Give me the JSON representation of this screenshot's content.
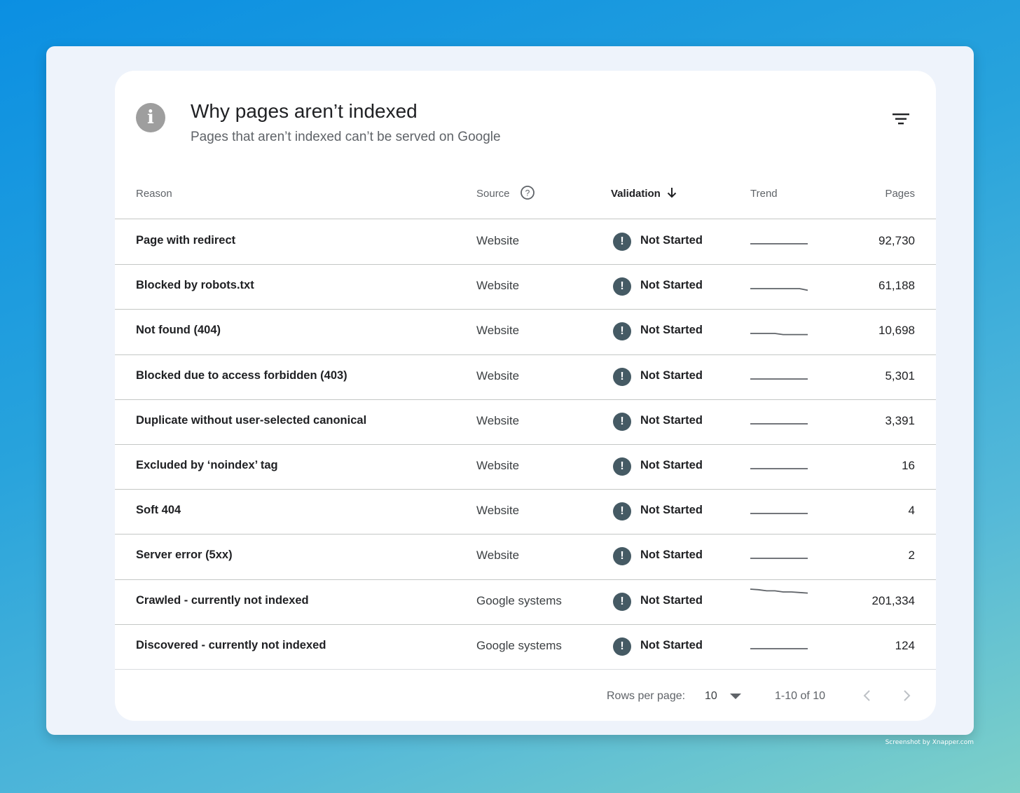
{
  "header": {
    "title": "Why pages aren’t indexed",
    "subtitle": "Pages that aren’t indexed can’t be served on Google",
    "info_icon": "info-icon",
    "filter_icon": "filter-icon"
  },
  "columns": {
    "reason": "Reason",
    "source": "Source",
    "validation": "Validation",
    "trend": "Trend",
    "pages": "Pages"
  },
  "rows": [
    {
      "reason": "Page with redirect",
      "source": "Website",
      "validation": "Not Started",
      "pages": "92,730",
      "trend": [
        1,
        1,
        1,
        1,
        1,
        1,
        1,
        1
      ]
    },
    {
      "reason": "Blocked by robots.txt",
      "source": "Website",
      "validation": "Not Started",
      "pages": "61,188",
      "trend": [
        1,
        1,
        1,
        1,
        1,
        1,
        1,
        0.97
      ]
    },
    {
      "reason": "Not found (404)",
      "source": "Website",
      "validation": "Not Started",
      "pages": "10,698",
      "trend": [
        1,
        1,
        1,
        1,
        0.98,
        0.98,
        0.98,
        0.98
      ]
    },
    {
      "reason": "Blocked due to access forbidden (403)",
      "source": "Website",
      "validation": "Not Started",
      "pages": "5,301",
      "trend": [
        1,
        1,
        1,
        1,
        1,
        1,
        1,
        1
      ]
    },
    {
      "reason": "Duplicate without user-selected canonical",
      "source": "Website",
      "validation": "Not Started",
      "pages": "3,391",
      "trend": [
        1,
        1,
        1,
        1,
        1,
        1,
        1,
        1
      ]
    },
    {
      "reason": "Excluded by ‘noindex’ tag",
      "source": "Website",
      "validation": "Not Started",
      "pages": "16",
      "trend": [
        1,
        1,
        1,
        1,
        1,
        1,
        1,
        1
      ]
    },
    {
      "reason": "Soft 404",
      "source": "Website",
      "validation": "Not Started",
      "pages": "4",
      "trend": [
        1,
        1,
        1,
        1,
        1,
        1,
        1,
        1
      ]
    },
    {
      "reason": "Server error (5xx)",
      "source": "Website",
      "validation": "Not Started",
      "pages": "2",
      "trend": [
        1,
        1,
        1,
        1,
        1,
        1,
        1,
        1
      ]
    },
    {
      "reason": "Crawled - currently not indexed",
      "source": "Google systems",
      "validation": "Not Started",
      "pages": "201,334",
      "trend": [
        1,
        0.99,
        0.97,
        0.97,
        0.95,
        0.95,
        0.94,
        0.93
      ]
    },
    {
      "reason": "Discovered - currently not indexed",
      "source": "Google systems",
      "validation": "Not Started",
      "pages": "124",
      "trend": [
        1,
        1,
        1,
        1,
        1,
        1,
        1,
        1
      ]
    }
  ],
  "footer": {
    "rows_per_page_label": "Rows per page:",
    "rows_per_page_value": "10",
    "range": "1-10 of 10"
  },
  "credit": "Screenshot by Xnapper.com",
  "colors": {
    "status_icon": "#455a64",
    "sparkline": "#5f6368"
  }
}
